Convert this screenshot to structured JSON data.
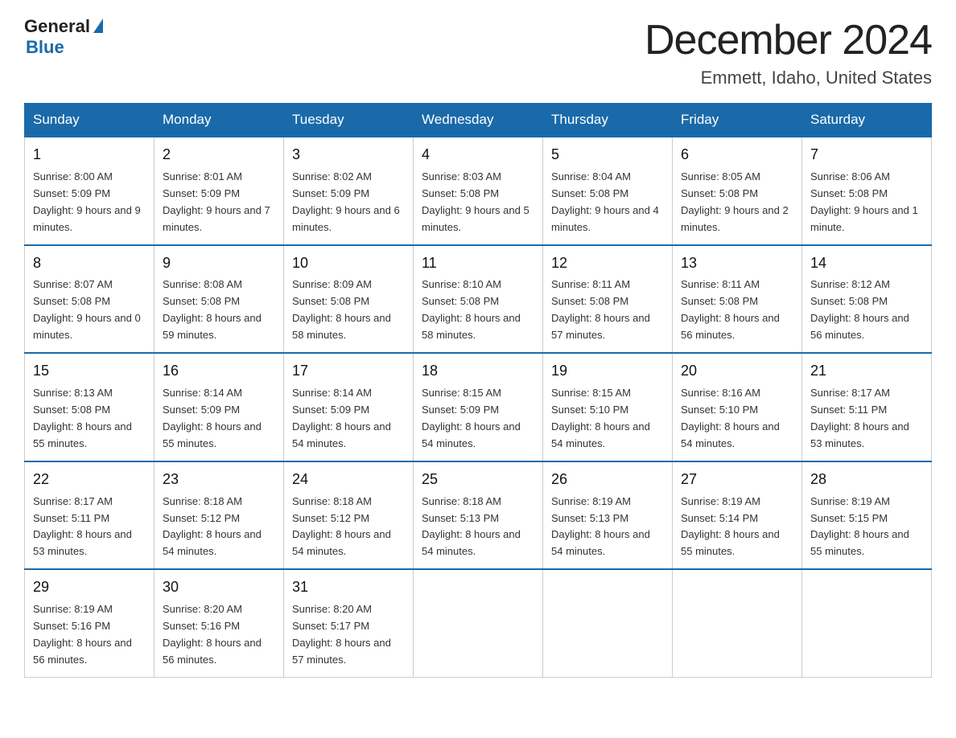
{
  "logo": {
    "general": "General",
    "triangle": "",
    "blue": "Blue"
  },
  "header": {
    "title": "December 2024",
    "subtitle": "Emmett, Idaho, United States"
  },
  "days_of_week": [
    "Sunday",
    "Monday",
    "Tuesday",
    "Wednesday",
    "Thursday",
    "Friday",
    "Saturday"
  ],
  "weeks": [
    [
      {
        "day": "1",
        "sunrise": "8:00 AM",
        "sunset": "5:09 PM",
        "daylight": "9 hours and 9 minutes."
      },
      {
        "day": "2",
        "sunrise": "8:01 AM",
        "sunset": "5:09 PM",
        "daylight": "9 hours and 7 minutes."
      },
      {
        "day": "3",
        "sunrise": "8:02 AM",
        "sunset": "5:09 PM",
        "daylight": "9 hours and 6 minutes."
      },
      {
        "day": "4",
        "sunrise": "8:03 AM",
        "sunset": "5:08 PM",
        "daylight": "9 hours and 5 minutes."
      },
      {
        "day": "5",
        "sunrise": "8:04 AM",
        "sunset": "5:08 PM",
        "daylight": "9 hours and 4 minutes."
      },
      {
        "day": "6",
        "sunrise": "8:05 AM",
        "sunset": "5:08 PM",
        "daylight": "9 hours and 2 minutes."
      },
      {
        "day": "7",
        "sunrise": "8:06 AM",
        "sunset": "5:08 PM",
        "daylight": "9 hours and 1 minute."
      }
    ],
    [
      {
        "day": "8",
        "sunrise": "8:07 AM",
        "sunset": "5:08 PM",
        "daylight": "9 hours and 0 minutes."
      },
      {
        "day": "9",
        "sunrise": "8:08 AM",
        "sunset": "5:08 PM",
        "daylight": "8 hours and 59 minutes."
      },
      {
        "day": "10",
        "sunrise": "8:09 AM",
        "sunset": "5:08 PM",
        "daylight": "8 hours and 58 minutes."
      },
      {
        "day": "11",
        "sunrise": "8:10 AM",
        "sunset": "5:08 PM",
        "daylight": "8 hours and 58 minutes."
      },
      {
        "day": "12",
        "sunrise": "8:11 AM",
        "sunset": "5:08 PM",
        "daylight": "8 hours and 57 minutes."
      },
      {
        "day": "13",
        "sunrise": "8:11 AM",
        "sunset": "5:08 PM",
        "daylight": "8 hours and 56 minutes."
      },
      {
        "day": "14",
        "sunrise": "8:12 AM",
        "sunset": "5:08 PM",
        "daylight": "8 hours and 56 minutes."
      }
    ],
    [
      {
        "day": "15",
        "sunrise": "8:13 AM",
        "sunset": "5:08 PM",
        "daylight": "8 hours and 55 minutes."
      },
      {
        "day": "16",
        "sunrise": "8:14 AM",
        "sunset": "5:09 PM",
        "daylight": "8 hours and 55 minutes."
      },
      {
        "day": "17",
        "sunrise": "8:14 AM",
        "sunset": "5:09 PM",
        "daylight": "8 hours and 54 minutes."
      },
      {
        "day": "18",
        "sunrise": "8:15 AM",
        "sunset": "5:09 PM",
        "daylight": "8 hours and 54 minutes."
      },
      {
        "day": "19",
        "sunrise": "8:15 AM",
        "sunset": "5:10 PM",
        "daylight": "8 hours and 54 minutes."
      },
      {
        "day": "20",
        "sunrise": "8:16 AM",
        "sunset": "5:10 PM",
        "daylight": "8 hours and 54 minutes."
      },
      {
        "day": "21",
        "sunrise": "8:17 AM",
        "sunset": "5:11 PM",
        "daylight": "8 hours and 53 minutes."
      }
    ],
    [
      {
        "day": "22",
        "sunrise": "8:17 AM",
        "sunset": "5:11 PM",
        "daylight": "8 hours and 53 minutes."
      },
      {
        "day": "23",
        "sunrise": "8:18 AM",
        "sunset": "5:12 PM",
        "daylight": "8 hours and 54 minutes."
      },
      {
        "day": "24",
        "sunrise": "8:18 AM",
        "sunset": "5:12 PM",
        "daylight": "8 hours and 54 minutes."
      },
      {
        "day": "25",
        "sunrise": "8:18 AM",
        "sunset": "5:13 PM",
        "daylight": "8 hours and 54 minutes."
      },
      {
        "day": "26",
        "sunrise": "8:19 AM",
        "sunset": "5:13 PM",
        "daylight": "8 hours and 54 minutes."
      },
      {
        "day": "27",
        "sunrise": "8:19 AM",
        "sunset": "5:14 PM",
        "daylight": "8 hours and 55 minutes."
      },
      {
        "day": "28",
        "sunrise": "8:19 AM",
        "sunset": "5:15 PM",
        "daylight": "8 hours and 55 minutes."
      }
    ],
    [
      {
        "day": "29",
        "sunrise": "8:19 AM",
        "sunset": "5:16 PM",
        "daylight": "8 hours and 56 minutes."
      },
      {
        "day": "30",
        "sunrise": "8:20 AM",
        "sunset": "5:16 PM",
        "daylight": "8 hours and 56 minutes."
      },
      {
        "day": "31",
        "sunrise": "8:20 AM",
        "sunset": "5:17 PM",
        "daylight": "8 hours and 57 minutes."
      },
      null,
      null,
      null,
      null
    ]
  ],
  "labels": {
    "sunrise": "Sunrise:",
    "sunset": "Sunset:",
    "daylight": "Daylight:"
  }
}
